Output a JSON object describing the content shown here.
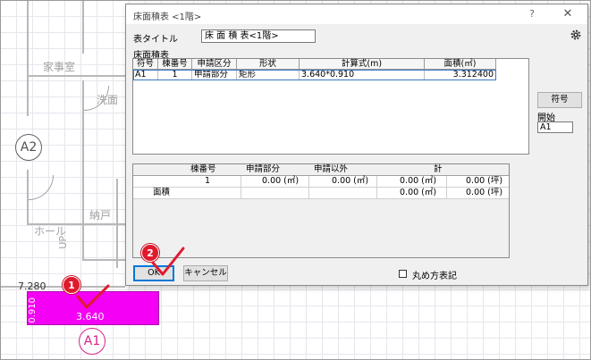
{
  "cad": {
    "rooms": {
      "kaji": "家事室",
      "senmen": "洗面",
      "nando": "納戸",
      "hall": "ホール",
      "up": "UP"
    },
    "axes": {
      "a2": "A2",
      "a1": "A1"
    },
    "dim_left": "7.280",
    "rect_width": "3.640",
    "rect_height": "0.910",
    "accent": "#f400f4",
    "steps": {
      "step1": "1",
      "step2": "2"
    }
  },
  "dialog": {
    "title": "床面積表 <1階>",
    "help": "?",
    "close": "✕",
    "table_title_label": "表タイトル",
    "table_title_value": "床 面 積 表<1階>",
    "section_label": "床面積表",
    "columns": [
      "符号",
      "棟番号",
      "申請区分",
      "形状",
      "計算式(m)",
      "面積(㎡)"
    ],
    "rows": [
      {
        "code": "A1",
        "building": "1",
        "category": "申請部分",
        "shape": "矩形",
        "formula": "3.640*0.910",
        "area": "3.312400"
      }
    ],
    "code_button": "符号",
    "start_label": "開始",
    "start_value": "A1",
    "summary": {
      "headers": {
        "building": "棟番号",
        "apply": "申請部分",
        "other": "申請以外",
        "total": "計"
      },
      "row1": {
        "building": "1",
        "apply": "0.00 (㎡)",
        "other": "0.00 (㎡)",
        "total_m2": "0.00 (㎡)",
        "total_tsubo": "0.00 (坪)"
      },
      "row2": {
        "label": "面積",
        "total_m2": "0.00 (㎡)",
        "total_tsubo": "0.00 (坪)"
      }
    },
    "ok": "OK",
    "cancel": "キャンセル",
    "round_label": "丸め方表記"
  }
}
